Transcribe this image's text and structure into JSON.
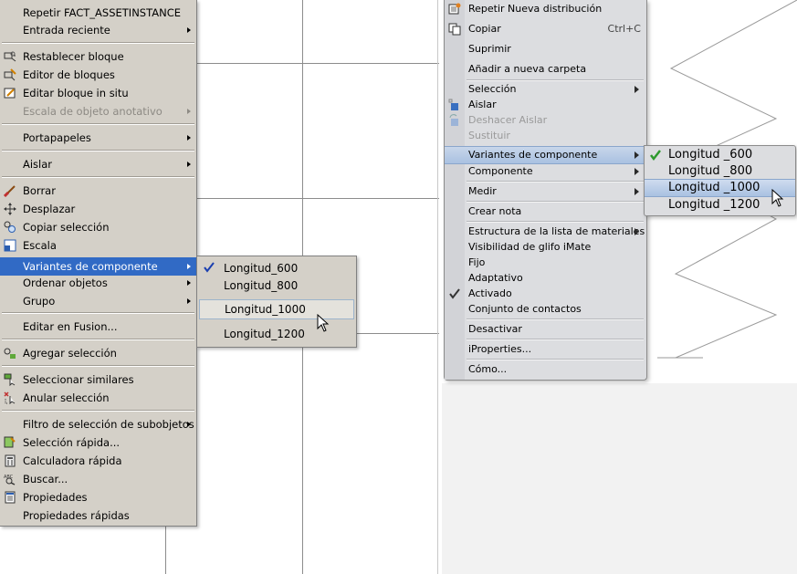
{
  "left_menu": {
    "items": [
      {
        "label": "Repetir FACT_ASSETINSTANCE",
        "icon": "",
        "submenu": false,
        "disabled": false
      },
      {
        "label": "Entrada reciente",
        "icon": "",
        "submenu": true,
        "disabled": false
      },
      {
        "label": "Restablecer bloque",
        "icon": "block-reset-icon",
        "submenu": false,
        "disabled": false
      },
      {
        "label": "Editor de bloques",
        "icon": "block-editor-icon",
        "submenu": false,
        "disabled": false
      },
      {
        "label": "Editar bloque in situ",
        "icon": "edit-block-icon",
        "submenu": false,
        "disabled": false
      },
      {
        "label": "Escala de objeto anotativo",
        "icon": "",
        "submenu": true,
        "disabled": true
      },
      {
        "label": "Portapapeles",
        "icon": "",
        "submenu": true,
        "disabled": false
      },
      {
        "label": "Aislar",
        "icon": "",
        "submenu": true,
        "disabled": false
      },
      {
        "label": "Borrar",
        "icon": "eraser-icon",
        "submenu": false,
        "disabled": false
      },
      {
        "label": "Desplazar",
        "icon": "move-icon",
        "submenu": false,
        "disabled": false
      },
      {
        "label": "Copiar selección",
        "icon": "copy-selection-icon",
        "submenu": false,
        "disabled": false
      },
      {
        "label": "Escala",
        "icon": "scale-icon",
        "submenu": false,
        "disabled": false
      },
      {
        "label": "Variantes de componente",
        "icon": "",
        "submenu": true,
        "disabled": false
      },
      {
        "label": "Ordenar objetos",
        "icon": "",
        "submenu": true,
        "disabled": false
      },
      {
        "label": "Grupo",
        "icon": "",
        "submenu": true,
        "disabled": false
      },
      {
        "label": "Editar en Fusion...",
        "icon": "",
        "submenu": false,
        "disabled": false
      },
      {
        "label": "Agregar selección",
        "icon": "add-selection-icon",
        "submenu": false,
        "disabled": false
      },
      {
        "label": "Seleccionar similares",
        "icon": "select-similar-icon",
        "submenu": false,
        "disabled": false
      },
      {
        "label": "Anular selección",
        "icon": "deselect-icon",
        "submenu": false,
        "disabled": false
      },
      {
        "label": "Filtro de selección de subobjetos",
        "icon": "",
        "submenu": true,
        "disabled": false
      },
      {
        "label": "Selección rápida...",
        "icon": "quick-select-icon",
        "submenu": false,
        "disabled": false
      },
      {
        "label": "Calculadora rápida",
        "icon": "calculator-icon",
        "submenu": false,
        "disabled": false
      },
      {
        "label": "Buscar...",
        "icon": "find-icon",
        "submenu": false,
        "disabled": false
      },
      {
        "label": "Propiedades",
        "icon": "properties-icon",
        "submenu": false,
        "disabled": false
      },
      {
        "label": "Propiedades rápidas",
        "icon": "",
        "submenu": false,
        "disabled": false
      }
    ],
    "highlighted": "Variantes de componente"
  },
  "left_submenu": {
    "items": [
      "Longitud_600",
      "Longitud_800",
      "Longitud_1000",
      "Longitud_1200"
    ],
    "checked": "Longitud_600",
    "hovered": "Longitud_1000"
  },
  "right_menu": {
    "items": [
      {
        "label": "Repetir Nueva distribución",
        "icon": "repeat-layout-icon",
        "shortcut": "",
        "submenu": false,
        "disabled": false
      },
      {
        "label": "Copiar",
        "icon": "copy-icon",
        "shortcut": "Ctrl+C",
        "submenu": false,
        "disabled": false
      },
      {
        "label": "Suprimir",
        "icon": "",
        "shortcut": "",
        "submenu": false,
        "disabled": false
      },
      {
        "label": "Añadir a nueva carpeta",
        "icon": "",
        "shortcut": "",
        "submenu": false,
        "disabled": false
      },
      {
        "label": "Selección",
        "icon": "",
        "shortcut": "",
        "submenu": true,
        "disabled": false
      },
      {
        "label": "Aislar",
        "icon": "isolate-icon",
        "shortcut": "",
        "submenu": false,
        "disabled": false
      },
      {
        "label": "Deshacer Aislar",
        "icon": "undo-isolate-icon",
        "shortcut": "",
        "submenu": false,
        "disabled": true
      },
      {
        "label": "Sustituir",
        "icon": "",
        "shortcut": "",
        "submenu": false,
        "disabled": true
      },
      {
        "label": "Variantes de componente",
        "icon": "",
        "shortcut": "",
        "submenu": true,
        "disabled": false
      },
      {
        "label": "Componente",
        "icon": "",
        "shortcut": "",
        "submenu": true,
        "disabled": false
      },
      {
        "label": "Medir",
        "icon": "",
        "shortcut": "",
        "submenu": true,
        "disabled": false
      },
      {
        "label": "Crear nota",
        "icon": "",
        "shortcut": "",
        "submenu": false,
        "disabled": false
      },
      {
        "label": "Estructura de la lista de materiales",
        "icon": "",
        "shortcut": "",
        "submenu": true,
        "disabled": false
      },
      {
        "label": "Visibilidad de glifo iMate",
        "icon": "",
        "shortcut": "",
        "submenu": false,
        "disabled": false
      },
      {
        "label": "Fijo",
        "icon": "",
        "shortcut": "",
        "submenu": false,
        "disabled": false
      },
      {
        "label": "Adaptativo",
        "icon": "",
        "shortcut": "",
        "submenu": false,
        "disabled": false
      },
      {
        "label": "Activado",
        "icon": "check-icon",
        "shortcut": "",
        "submenu": false,
        "disabled": false
      },
      {
        "label": "Conjunto de contactos",
        "icon": "",
        "shortcut": "",
        "submenu": false,
        "disabled": false
      },
      {
        "label": "Desactivar",
        "icon": "",
        "shortcut": "",
        "submenu": false,
        "disabled": false
      },
      {
        "label": "iProperties...",
        "icon": "",
        "shortcut": "",
        "submenu": false,
        "disabled": false
      },
      {
        "label": "Cómo...",
        "icon": "",
        "shortcut": "",
        "submenu": false,
        "disabled": false
      }
    ],
    "highlighted": "Variantes de componente"
  },
  "right_submenu": {
    "items": [
      "Longitud _600",
      "Longitud _800",
      "Longitud _1000",
      "Longitud _1200"
    ],
    "checked": "Longitud _600",
    "hovered": "Longitud _1000"
  },
  "colors": {
    "classic_menu": "#d4d0c8",
    "classic_highlight": "#316ac5",
    "modern_menu": "#dcdde0",
    "modern_highlight": "#b8cce6",
    "check_green": "#2e9a2e",
    "check_blue": "#1a3fb0"
  }
}
